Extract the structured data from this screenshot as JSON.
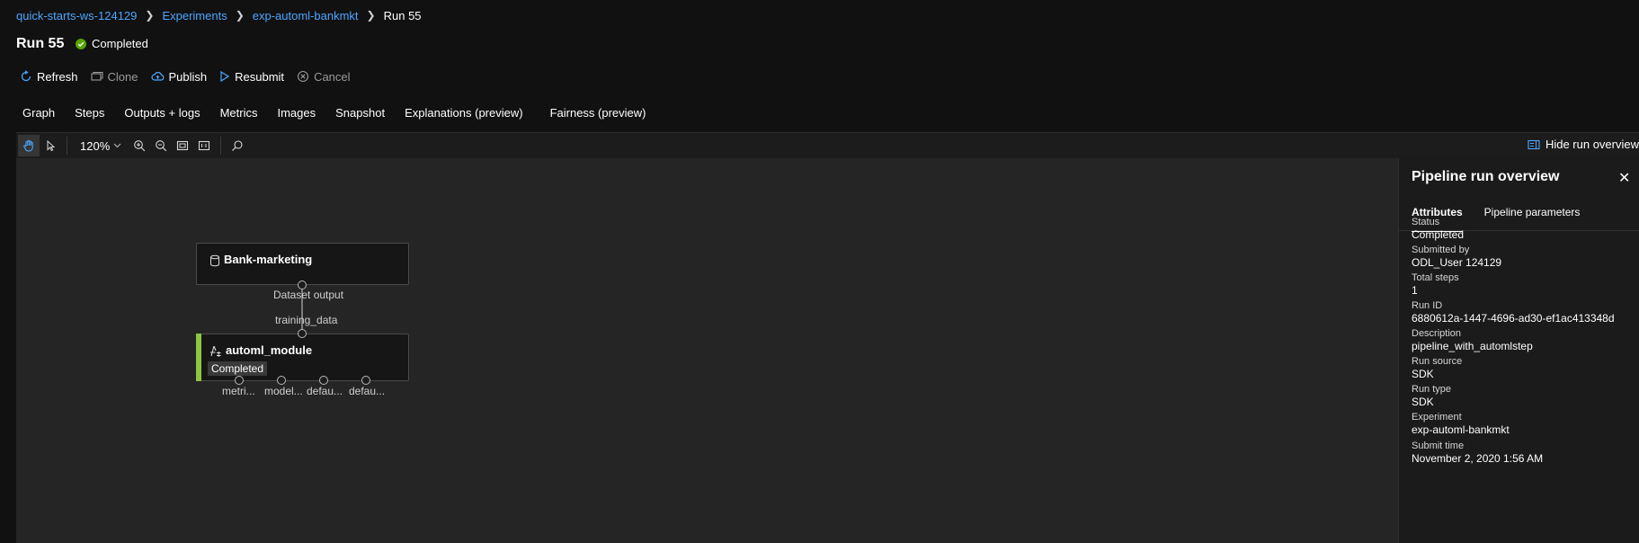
{
  "breadcrumb": {
    "workspace": "quick-starts-ws-124129",
    "experiments": "Experiments",
    "experiment": "exp-automl-bankmkt",
    "run": "Run 55"
  },
  "title": "Run 55",
  "status": "Completed",
  "toolbar": {
    "refresh": "Refresh",
    "clone": "Clone",
    "publish": "Publish",
    "resubmit": "Resubmit",
    "cancel": "Cancel"
  },
  "tabs": [
    "Graph",
    "Steps",
    "Outputs + logs",
    "Metrics",
    "Images",
    "Snapshot",
    "Explanations (preview)",
    "Fairness (preview)"
  ],
  "active_tab": "Graph",
  "canvas_toolbar": {
    "zoom": "120%",
    "hide_overview": "Hide run overview"
  },
  "graph": {
    "dataset_node": {
      "title": "Bank-marketing",
      "output_label": "Dataset output"
    },
    "edge_label": "training_data",
    "module_node": {
      "title": "automl_module",
      "status": "Completed",
      "outputs": [
        "metri...",
        "model...",
        "defau...",
        "defau..."
      ]
    }
  },
  "panel": {
    "title": "Pipeline run overview",
    "tabs": [
      "Attributes",
      "Pipeline parameters"
    ],
    "attributes": [
      {
        "label": "Status",
        "value": "Completed"
      },
      {
        "label": "Submitted by",
        "value": "ODL_User 124129"
      },
      {
        "label": "Total steps",
        "value": "1"
      },
      {
        "label": "Run ID",
        "value": "6880612a-1447-4696-ad30-ef1ac413348d"
      },
      {
        "label": "Description",
        "value": "pipeline_with_automlstep"
      },
      {
        "label": "Run source",
        "value": "SDK"
      },
      {
        "label": "Run type",
        "value": "SDK"
      },
      {
        "label": "Experiment",
        "value": "exp-automl-bankmkt"
      },
      {
        "label": "Submit time",
        "value": "November 2, 2020 1:56 AM"
      }
    ]
  },
  "colors": {
    "accent": "#4da6ff",
    "success": "#57a300",
    "module_bar": "#8cc63f"
  }
}
